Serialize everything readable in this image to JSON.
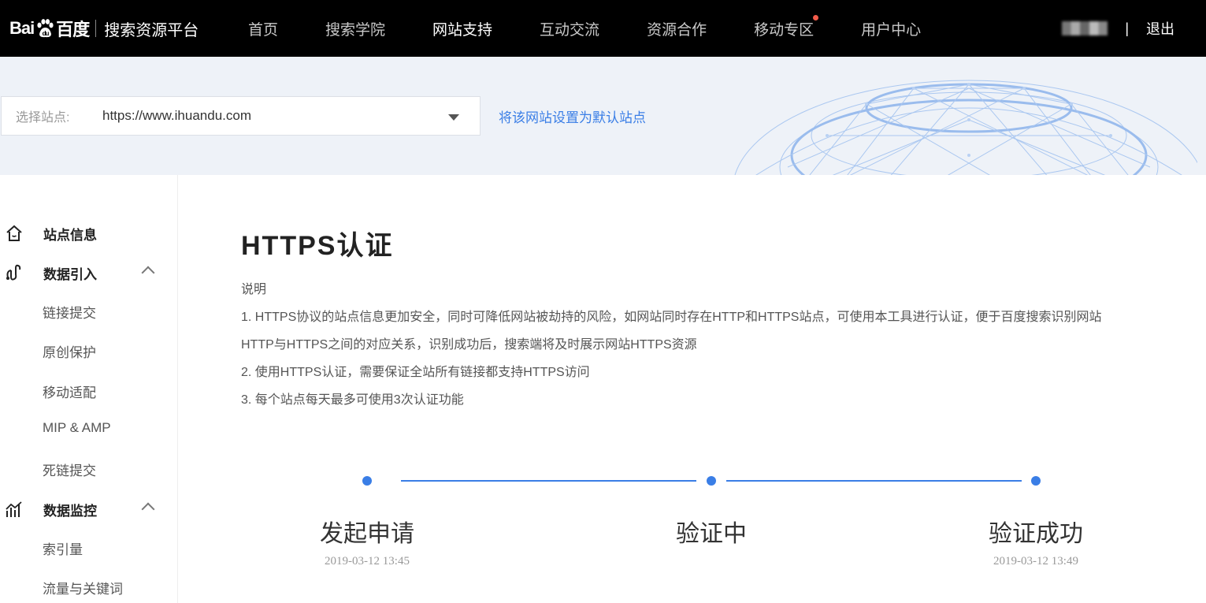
{
  "header": {
    "logo_text_en": "Bai",
    "logo_text_du": "du",
    "logo_text_cn": "百度",
    "platform_name": "搜索资源平台",
    "nav": [
      {
        "label": "首页",
        "active": false
      },
      {
        "label": "搜索学院",
        "active": false
      },
      {
        "label": "网站支持",
        "active": true
      },
      {
        "label": "互动交流",
        "active": false
      },
      {
        "label": "资源合作",
        "active": false
      },
      {
        "label": "移动专区",
        "active": false,
        "badge_dot": true
      },
      {
        "label": "用户中心",
        "active": false
      }
    ],
    "separator": "|",
    "logout": "退出"
  },
  "banner": {
    "select_label": "选择站点:",
    "selected_site": "https://www.ihuandu.com",
    "set_default_link": "将该网站设置为默认站点"
  },
  "sidebar": {
    "groups": [
      {
        "label": "站点信息",
        "icon": "home-icon"
      },
      {
        "label": "数据引入",
        "icon": "data-import-icon",
        "expanded": true,
        "items": [
          "链接提交",
          "原创保护",
          "移动适配",
          "MIP & AMP",
          "死链提交"
        ]
      },
      {
        "label": "数据监控",
        "icon": "monitor-chart-icon",
        "expanded": true,
        "items": [
          "索引量",
          "流量与关键词"
        ]
      }
    ]
  },
  "main": {
    "title": "HTTPS认证",
    "desc_heading": "说明",
    "desc_lines": [
      "1. HTTPS协议的站点信息更加安全，同时可降低网站被劫持的风险，如网站同时存在HTTP和HTTPS站点，可使用本工具进行认证，便于百度搜索识别网站",
      "HTTP与HTTPS之间的对应关系，识别成功后，搜索端将及时展示网站HTTPS资源",
      "2. 使用HTTPS认证，需要保证全站所有链接都支持HTTPS访问",
      "3. 每个站点每天最多可使用3次认证功能"
    ],
    "steps": [
      {
        "label": "发起申请",
        "time": "2019-03-12 13:45"
      },
      {
        "label": "验证中",
        "time": ""
      },
      {
        "label": "验证成功",
        "time": "2019-03-12 13:49"
      }
    ],
    "accent_color": "#3a7ee6"
  }
}
